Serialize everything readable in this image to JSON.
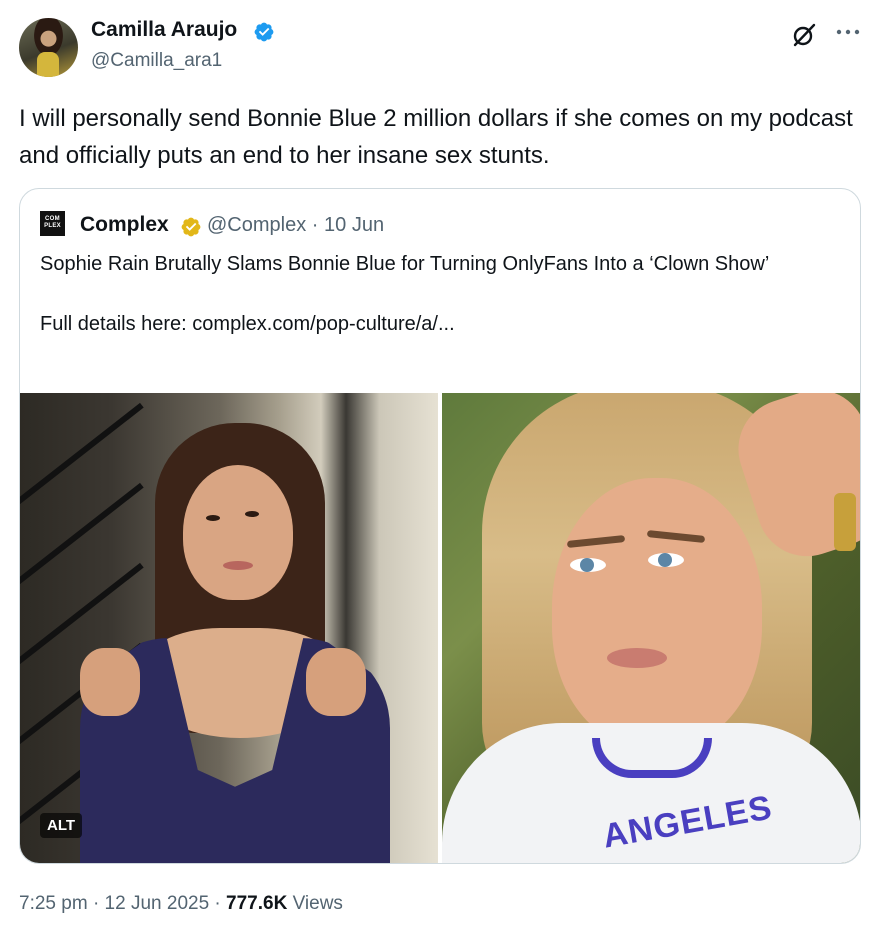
{
  "author": {
    "name": "Camilla Araujo",
    "handle": "@Camilla_ara1"
  },
  "tweet": {
    "text": "I will personally send Bonnie Blue 2 million dollars if she comes on my podcast and officially puts an end to her insane sex stunts."
  },
  "quote": {
    "logo_text": "COM PLEX",
    "name": "Complex",
    "handle": "@Complex",
    "separator": "·",
    "date": "10 Jun",
    "text_line1": "Sophie Rain Brutally Slams Bonnie Blue for Turning OnlyFans Into a ‘Clown Show’",
    "text_line2": "Full details here: complex.com/pop-culture/a/...",
    "alt_badge": "ALT",
    "right_image_shirt_text": "ANGELES"
  },
  "footer": {
    "time": "7:25 pm",
    "sep1": "·",
    "date": "12 Jun 2025",
    "sep2": "·",
    "views_count": "777.6K",
    "views_label": "Views"
  },
  "icons": {
    "verified": "verified-badge-icon",
    "quote_verified": "gold-verified-badge-icon",
    "grok": "grok-icon",
    "more": "more-options-icon"
  },
  "colors": {
    "verified_blue": "#1d9bf0",
    "verified_gold": "#e2b719",
    "secondary_text": "#536471",
    "primary_text": "#0f1419",
    "border": "#cfd9de"
  }
}
